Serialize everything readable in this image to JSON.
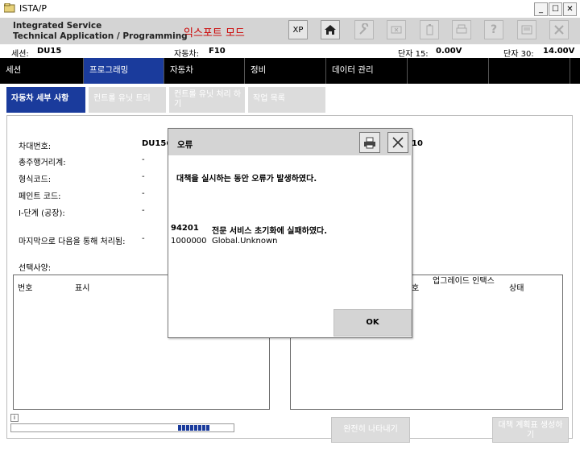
{
  "window": {
    "title": "ISTA/P"
  },
  "header": {
    "line1": "Integrated Service",
    "line2": "Technical Application / Programming",
    "mode": "익스포트 모드",
    "xp_label": "XP"
  },
  "status": {
    "session_label": "세션:",
    "session_value": "DU15",
    "vehicle_label": "자동차:",
    "vehicle_value": "F10",
    "t15_label": "단자 15:",
    "t15_value": "0.00V",
    "t30_label": "단자 30:",
    "t30_value": "14.00V"
  },
  "nav": {
    "items": [
      {
        "label": "세션"
      },
      {
        "label": "프로그래밍"
      },
      {
        "label": "자동차"
      },
      {
        "label": "정비"
      },
      {
        "label": "데이터 관리"
      }
    ]
  },
  "subtabs": [
    {
      "label": "자동차 세부 사항"
    },
    {
      "label": "컨트롤 유닛 트리"
    },
    {
      "label": "컨트롤 유닛 처리 하기"
    },
    {
      "label": "작업 목록"
    }
  ],
  "details": {
    "chassis_label": "차대번호:",
    "chassis_value": "DU156",
    "mileage_label": "총주행거리계:",
    "mileage_value": "-",
    "type_label": "형식코드:",
    "type_value": "-",
    "paint_label": "페인트 코드:",
    "paint_value": "-",
    "istage_label": "I-단계 (공장):",
    "istage_value": "-",
    "last_label": "마지막으로 다음을 통해 처리됨:",
    "last_value": "-",
    "right_value": "10",
    "options_label": "선택사양:"
  },
  "left_table": {
    "col_no": "번호",
    "col_display": "표시"
  },
  "right_table": {
    "col_no": "호",
    "col_upgrade": "업그레이드 인택스",
    "col_status": "상태"
  },
  "bottom": {
    "show_all": "완전히 나타내기",
    "plan_button": "대책 계획표 생성하기",
    "info_label": "i",
    "progress_blocks": 8
  },
  "dialog": {
    "title": "오류",
    "message": "대책을 실시하는 동안 오류가 발생하였다.",
    "errors": [
      {
        "code": "94201",
        "text": "전문 서비스 초기화에 실패하였다."
      },
      {
        "code": "1000000",
        "text": "Global.Unknown"
      }
    ],
    "ok_label": "OK"
  }
}
